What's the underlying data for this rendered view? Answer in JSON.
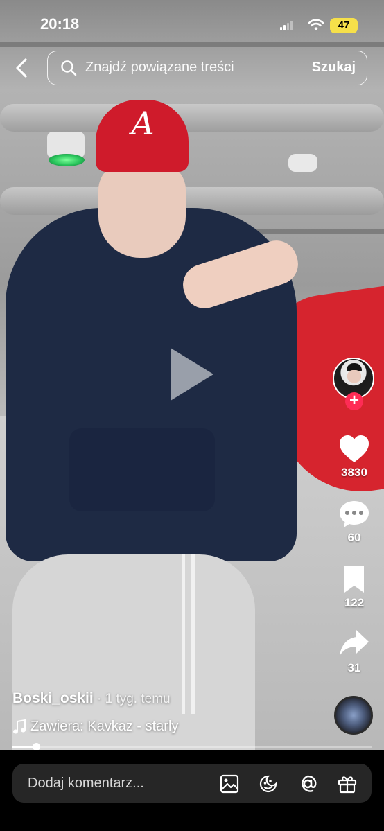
{
  "status_bar": {
    "time": "20:18",
    "battery": "47",
    "battery_color": "#f6e04a"
  },
  "search": {
    "placeholder": "Znajdź powiązane treści",
    "button_label": "Szukaj"
  },
  "video": {
    "cap_logo": "A"
  },
  "actions": {
    "likes": "3830",
    "comments": "60",
    "saves": "122",
    "shares": "31",
    "follow_symbol": "+"
  },
  "caption": {
    "author": "Boski_oskii",
    "time_ago": "· 1 tyg. temu",
    "music": "Zawiera: Kavkaz - starly"
  },
  "progress": {
    "fraction": 0.065
  },
  "comment_bar": {
    "placeholder": "Dodaj komentarz..."
  },
  "colors": {
    "accent": "#fe2c55",
    "background": "#000000",
    "comment_pill": "#262626"
  },
  "icons": [
    "back-icon",
    "search-icon",
    "play-icon",
    "heart-icon",
    "comment-icon",
    "bookmark-icon",
    "share-icon",
    "music-note-icon",
    "image-icon",
    "emoji-icon",
    "mention-icon",
    "gift-icon"
  ]
}
